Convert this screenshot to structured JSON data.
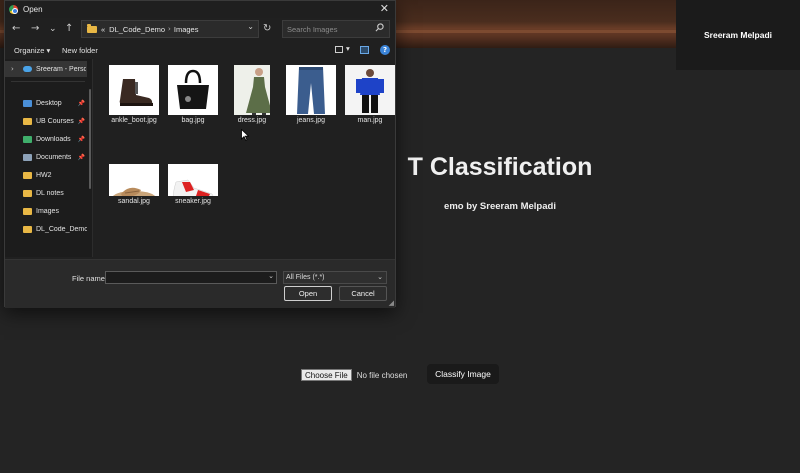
{
  "background_page": {
    "user_name": "Sreeram Melpadi",
    "title": "T Classification",
    "subtitle": "emo by Sreeram Melpadi",
    "file_input": {
      "button_label": "Choose File",
      "status": "No file chosen"
    },
    "classify_label": "Classify Image"
  },
  "dialog": {
    "title": "Open",
    "close_glyph": "✕",
    "nav": {
      "back": "←",
      "forward": "→",
      "recent": "⌄",
      "up": "↑",
      "refresh": "↻"
    },
    "breadcrumb": [
      "«",
      "DL_Code_Demo",
      "Images"
    ],
    "search_placeholder": "Search Images",
    "toolbar": {
      "organize": "Organize ▾",
      "new_folder": "New folder"
    },
    "sidebar": [
      {
        "label": "Sreeram - Personal",
        "icon": "onedrive-icon",
        "color": "#4aa3e8",
        "active": true,
        "chevron": "›"
      },
      {
        "label": "Desktop",
        "icon": "desktop-icon",
        "color": "#4a8fd8",
        "pinned": true
      },
      {
        "label": "UB Courses",
        "icon": "folder-icon",
        "color": "#e8b745",
        "pinned": true
      },
      {
        "label": "Downloads",
        "icon": "download-icon",
        "color": "#3fae6b",
        "pinned": true
      },
      {
        "label": "Documents",
        "icon": "documents-icon",
        "color": "#8da2b8",
        "pinned": true
      },
      {
        "label": "HW2",
        "icon": "folder-icon",
        "color": "#e8b745"
      },
      {
        "label": "DL notes",
        "icon": "folder-icon",
        "color": "#e8b745"
      },
      {
        "label": "Images",
        "icon": "folder-icon",
        "color": "#e8b745"
      },
      {
        "label": "DL_Code_Demo",
        "icon": "folder-icon",
        "color": "#e8b745"
      }
    ],
    "files": [
      {
        "name": "ankle_boot.jpg",
        "kind": "ankle-boot"
      },
      {
        "name": "bag.jpg",
        "kind": "bag"
      },
      {
        "name": "dress.jpg",
        "kind": "dress"
      },
      {
        "name": "jeans.jpg",
        "kind": "jeans"
      },
      {
        "name": "man.jpg",
        "kind": "man"
      },
      {
        "name": "sandal.jpg",
        "kind": "sandal"
      },
      {
        "name": "sneaker.jpg",
        "kind": "sneaker"
      }
    ],
    "footer": {
      "file_name_label": "File name:",
      "file_name_value": "",
      "file_type": "All Files (*.*)",
      "open_label": "Open",
      "cancel_label": "Cancel"
    }
  }
}
